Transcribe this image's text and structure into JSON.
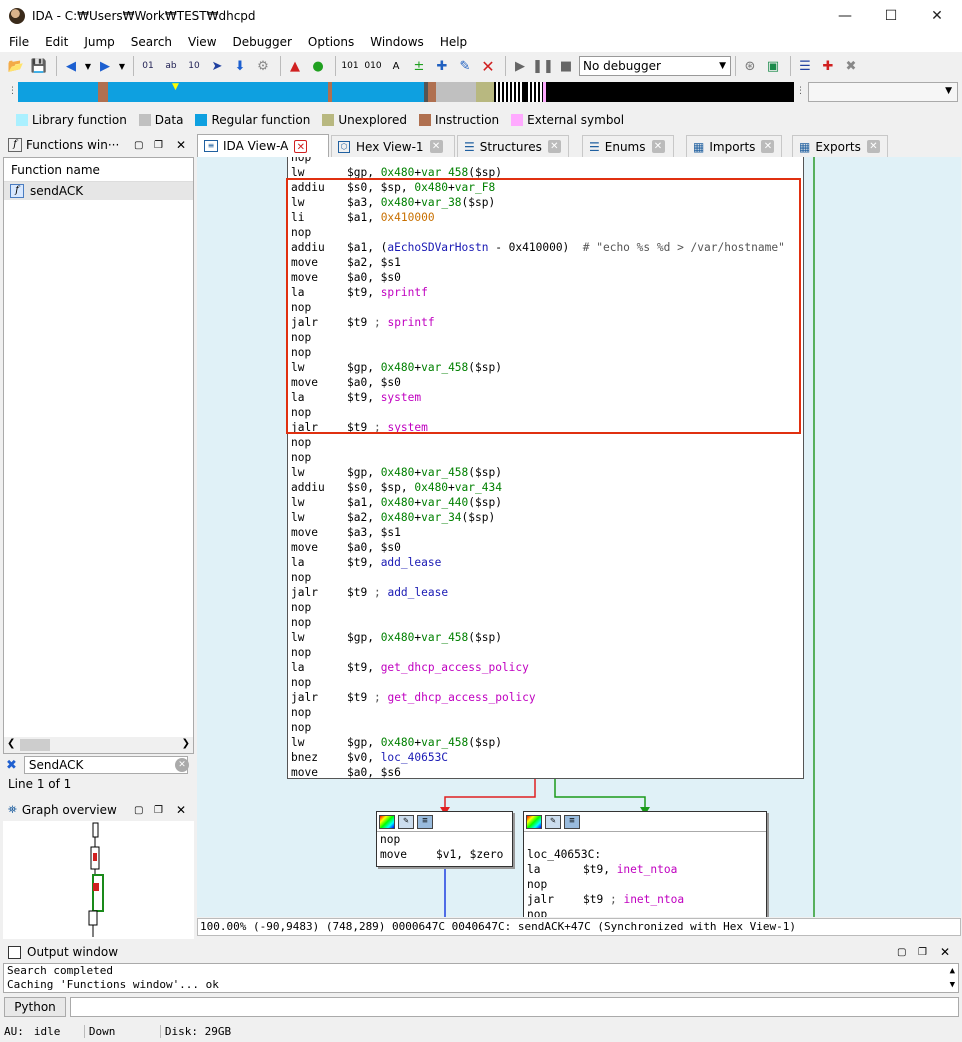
{
  "window": {
    "title": "IDA - C:₩Users₩Work₩TEST₩dhcpd"
  },
  "menu": [
    "File",
    "Edit",
    "Jump",
    "Search",
    "View",
    "Debugger",
    "Options",
    "Windows",
    "Help"
  ],
  "toolbar": {
    "debugger_select": "No debugger"
  },
  "legend": [
    {
      "label": "Library function",
      "color": "#aaf0ff"
    },
    {
      "label": "Data",
      "color": "#c0c0c0"
    },
    {
      "label": "Regular function",
      "color": "#0ea0e0"
    },
    {
      "label": "Unexplored",
      "color": "#b8b880"
    },
    {
      "label": "Instruction",
      "color": "#b07050"
    },
    {
      "label": "External symbol",
      "color": "#ffaaff"
    }
  ],
  "functions_panel": {
    "title": "Functions win···",
    "column": "Function name",
    "items": [
      "sendACK"
    ],
    "search_value": "SendACK",
    "line_info": "Line 1 of 1"
  },
  "graph_overview": {
    "title": "Graph overview"
  },
  "tabs": [
    "IDA View-A",
    "Hex View-1",
    "Structures",
    "Enums",
    "Imports",
    "Exports"
  ],
  "main_block": [
    {
      "op": "nop",
      "args": ""
    },
    {
      "op": "lw",
      "args": "$gp, 0x480+var_458($sp)"
    },
    {
      "op": "addiu",
      "args": "$s0, $sp, 0x480+var_F8"
    },
    {
      "op": "lw",
      "args": "$a3, 0x480+var_38($sp)"
    },
    {
      "op": "li",
      "args": "$a1, 0x410000"
    },
    {
      "op": "nop",
      "args": ""
    },
    {
      "op": "addiu",
      "args": "$a1, (aEchoSDVarHostn - 0x410000)  # \"echo %s %d > /var/hostname\""
    },
    {
      "op": "move",
      "args": "$a2, $s1"
    },
    {
      "op": "move",
      "args": "$a0, $s0"
    },
    {
      "op": "la",
      "args": "$t9, sprintf"
    },
    {
      "op": "nop",
      "args": ""
    },
    {
      "op": "jalr",
      "args": "$t9 ; sprintf"
    },
    {
      "op": "nop",
      "args": ""
    },
    {
      "op": "nop",
      "args": ""
    },
    {
      "op": "lw",
      "args": "$gp, 0x480+var_458($sp)"
    },
    {
      "op": "move",
      "args": "$a0, $s0"
    },
    {
      "op": "la",
      "args": "$t9, system"
    },
    {
      "op": "nop",
      "args": ""
    },
    {
      "op": "jalr",
      "args": "$t9 ; system"
    },
    {
      "op": "nop",
      "args": ""
    },
    {
      "op": "nop",
      "args": ""
    },
    {
      "op": "lw",
      "args": "$gp, 0x480+var_458($sp)"
    },
    {
      "op": "addiu",
      "args": "$s0, $sp, 0x480+var_434"
    },
    {
      "op": "lw",
      "args": "$a1, 0x480+var_440($sp)"
    },
    {
      "op": "lw",
      "args": "$a2, 0x480+var_34($sp)"
    },
    {
      "op": "move",
      "args": "$a3, $s1"
    },
    {
      "op": "move",
      "args": "$a0, $s0"
    },
    {
      "op": "la",
      "args": "$t9, add_lease"
    },
    {
      "op": "nop",
      "args": ""
    },
    {
      "op": "jalr",
      "args": "$t9 ; add_lease"
    },
    {
      "op": "nop",
      "args": ""
    },
    {
      "op": "nop",
      "args": ""
    },
    {
      "op": "lw",
      "args": "$gp, 0x480+var_458($sp)"
    },
    {
      "op": "nop",
      "args": ""
    },
    {
      "op": "la",
      "args": "$t9, get_dhcp_access_policy"
    },
    {
      "op": "nop",
      "args": ""
    },
    {
      "op": "jalr",
      "args": "$t9 ; get_dhcp_access_policy"
    },
    {
      "op": "nop",
      "args": ""
    },
    {
      "op": "nop",
      "args": ""
    },
    {
      "op": "lw",
      "args": "$gp, 0x480+var_458($sp)"
    },
    {
      "op": "bnez",
      "args": "$v0, loc_40653C"
    },
    {
      "op": "move",
      "args": "$a0, $s6"
    }
  ],
  "left_block": [
    {
      "op": "nop",
      "args": ""
    },
    {
      "op": "move",
      "args": "$v1, $zero"
    }
  ],
  "right_block": {
    "label": "loc_40653C:",
    "lines": [
      {
        "op": "la",
        "args": "$t9, inet_ntoa"
      },
      {
        "op": "nop",
        "args": ""
      },
      {
        "op": "jalr",
        "args": "$t9 ; inet_ntoa"
      },
      {
        "op": "nop",
        "args": ""
      }
    ]
  },
  "status_line": "100.00% (-90,9483) (748,289) 0000647C 0040647C: sendACK+47C (Synchronized with Hex View-1)",
  "output": {
    "title": "Output window",
    "lines": [
      "Search completed",
      "Caching 'Functions window'... ok"
    ],
    "python_button": "Python"
  },
  "bottom_status": {
    "au": "AU:",
    "state": "idle",
    "direction": "Down",
    "disk": "Disk: 29GB"
  }
}
